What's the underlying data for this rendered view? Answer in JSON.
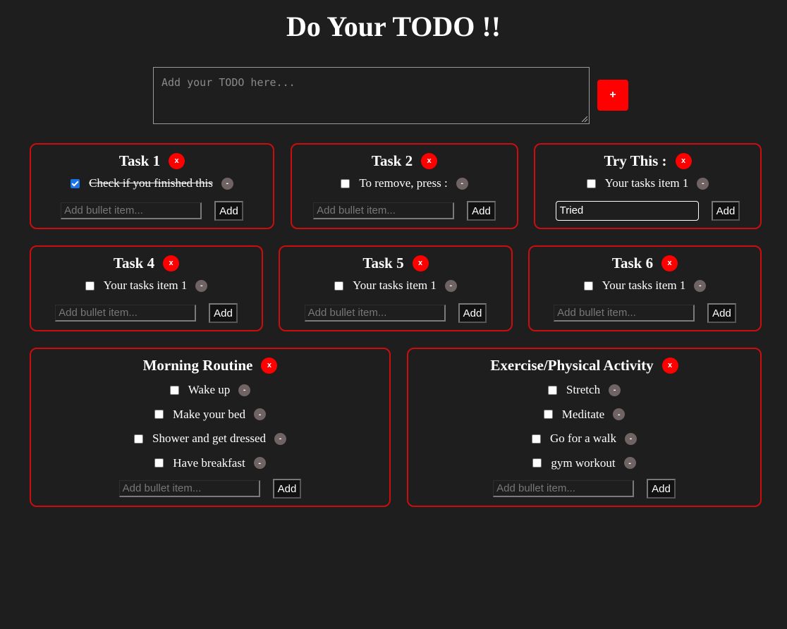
{
  "header": {
    "title": "Do Your TODO !!"
  },
  "new_todo": {
    "placeholder": "Add your TODO here...",
    "add_label": "+"
  },
  "bullet_placeholder": "Add bullet item...",
  "add_label": "Add",
  "delete_label": "x",
  "remove_label": "-",
  "cards": [
    {
      "title": "Task 1",
      "items": [
        {
          "text": "Check if you finished this",
          "checked": true
        }
      ],
      "input_value": ""
    },
    {
      "title": "Task 2",
      "items": [
        {
          "text": "To remove, press :",
          "checked": false
        }
      ],
      "input_value": ""
    },
    {
      "title": "Try This :",
      "items": [
        {
          "text": "Your tasks item 1",
          "checked": false
        }
      ],
      "input_value": "Tried"
    },
    {
      "title": "Task 4",
      "items": [
        {
          "text": "Your tasks item 1",
          "checked": false
        }
      ],
      "input_value": ""
    },
    {
      "title": "Task 5",
      "items": [
        {
          "text": "Your tasks item 1",
          "checked": false
        }
      ],
      "input_value": ""
    },
    {
      "title": "Task 6",
      "items": [
        {
          "text": "Your tasks item 1",
          "checked": false
        }
      ],
      "input_value": ""
    },
    {
      "title": "Morning Routine",
      "items": [
        {
          "text": "Wake up",
          "checked": false
        },
        {
          "text": "Make your bed",
          "checked": false
        },
        {
          "text": "Shower and get dressed",
          "checked": false
        },
        {
          "text": "Have breakfast",
          "checked": false
        }
      ],
      "input_value": ""
    },
    {
      "title": "Exercise/Physical Activity",
      "items": [
        {
          "text": "Stretch",
          "checked": false
        },
        {
          "text": "Meditate",
          "checked": false
        },
        {
          "text": "Go for a walk",
          "checked": false
        },
        {
          "text": "gym workout",
          "checked": false
        }
      ],
      "input_value": ""
    }
  ]
}
